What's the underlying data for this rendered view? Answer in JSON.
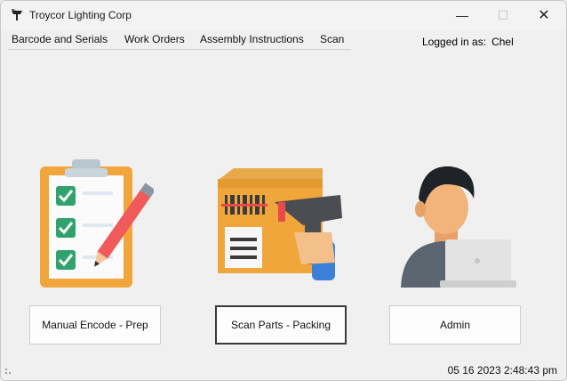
{
  "window": {
    "title": "Troycor Lighting Corp",
    "minimize": "—",
    "maximize": "☐",
    "close": "✕"
  },
  "menu": {
    "items": [
      "Barcode and Serials",
      "Work Orders",
      "Assembly Instructions",
      "Scan"
    ]
  },
  "login": {
    "label": "Logged in as:",
    "user": "Chel"
  },
  "actions": [
    {
      "label": "Manual Encode - Prep",
      "icon": "checklist-clipboard-pencil-icon"
    },
    {
      "label": "Scan Parts - Packing",
      "icon": "box-barcode-scanner-icon"
    },
    {
      "label": "Admin",
      "icon": "user-laptop-icon"
    }
  ],
  "status": {
    "datetime": "05 16 2023 2:48:43 pm"
  },
  "colors": {
    "orange": "#f0a63a",
    "green": "#2fa36b",
    "pencil": "#f05a5a",
    "laptop": "#e3e3e3"
  }
}
